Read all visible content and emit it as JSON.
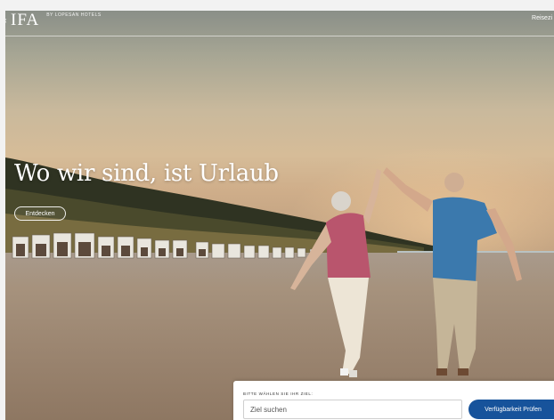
{
  "header": {
    "logo_text": "IFA",
    "logo_subtitle": "BY LOPESAN HOTELS",
    "nav_right_label": "Reisezi"
  },
  "hero": {
    "title": "Wo wir sind, ist Urlaub",
    "explore_button_label": "Entdecken",
    "image_description_icon": "beach-couple-photo"
  },
  "booking": {
    "label": "BITTE WÄHLEN SIE IHR ZIEL:",
    "destination_placeholder": "Ziel suchen",
    "submit_label": "Verfügbarkeit Prüfen"
  },
  "colors": {
    "primary_button": "#17539b",
    "hero_text": "#ffffff",
    "panel_bg": "#ffffff"
  }
}
